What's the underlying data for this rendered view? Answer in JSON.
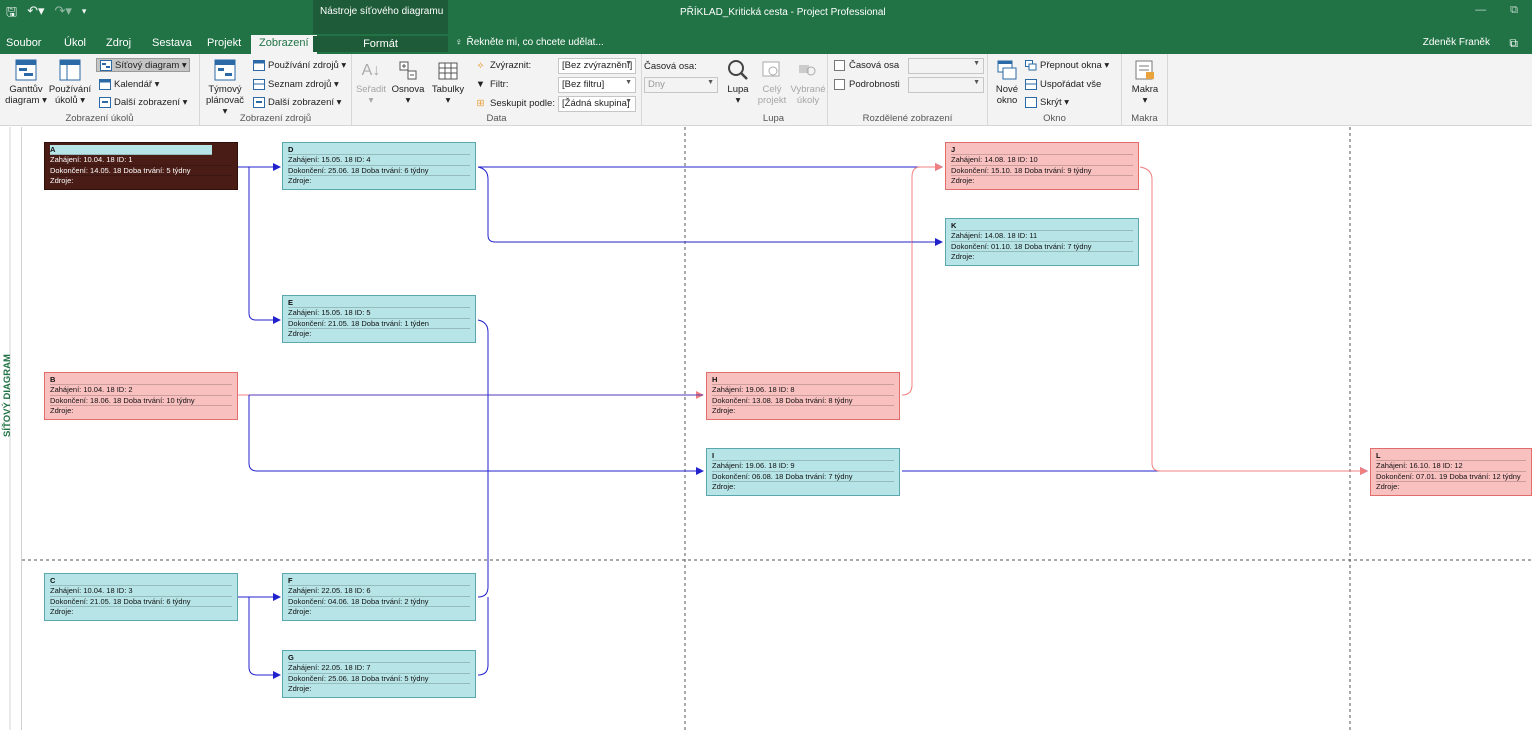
{
  "titlebar": {
    "context_title": "Nástroje síťového diagramu",
    "window_title": "PŘÍKLAD_Kritická cesta - Project Professional",
    "save_icon": "save-icon",
    "undo_icon": "undo-icon",
    "redo_icon": "redo-icon"
  },
  "tabs": {
    "soubor": "Soubor",
    "ukol": "Úkol",
    "zdroj": "Zdroj",
    "sestava": "Sestava",
    "projekt": "Projekt",
    "zobrazeni": "Zobrazení",
    "format": "Formát",
    "tell_me": "Řekněte mi, co chcete udělat...",
    "user": "Zdeněk Franěk"
  },
  "ribbon": {
    "task_views": {
      "gantt_l1": "Ganttův",
      "gantt_l2": "diagram ▾",
      "task_usage_l1": "Používání",
      "task_usage_l2": "úkolů ▾",
      "network": "Síťový diagram ▾",
      "calendar": "Kalendář ▾",
      "other": "Další zobrazení ▾",
      "label": "Zobrazení úkolů"
    },
    "resource_views": {
      "team_l1": "Týmový",
      "team_l2": "plánovač ▾",
      "usage": "Používání zdrojů ▾",
      "sheet": "Seznam zdrojů ▾",
      "other": "Další zobrazení ▾",
      "label": "Zobrazení zdrojů"
    },
    "data": {
      "sort": "Seřadit",
      "outline": "Osnova",
      "tables": "Tabulky",
      "highlight": "Zvýraznit:",
      "highlight_value": "[Bez zvýraznění]",
      "filter": "Filtr:",
      "filter_value": "[Bez filtru]",
      "group": "Seskupit podle:",
      "group_value": "[Žádná skupina]",
      "timescale": "Časová osa:",
      "timescale_value": "Dny",
      "label": "Data"
    },
    "zoom": {
      "zoom": "Lupa",
      "whole_l1": "Celý",
      "whole_l2": "projekt",
      "selected_l1": "Vybrané",
      "selected_l2": "úkoly",
      "label": "Lupa"
    },
    "split": {
      "timeline": "Časová osa",
      "details": "Podrobnosti",
      "label": "Rozdělené zobrazení"
    },
    "window": {
      "new_l1": "Nové",
      "new_l2": "okno",
      "switch": "Přepnout okna ▾",
      "arrange": "Uspořádat vše",
      "hide": "Skrýt ▾",
      "label": "Okno"
    },
    "macros": {
      "macros": "Makra",
      "label": "Makra"
    }
  },
  "view_label": "SÍŤOVÝ DIAGRAM",
  "nodes": {
    "A": {
      "name": "A",
      "start": "Zahájení: 10.04. 18   ID: 1",
      "finish": "Dokončení: 14.05. 18 Doba trvání: 5 týdny",
      "res": "Zdroje:"
    },
    "B": {
      "name": "B",
      "start": "Zahájení: 10.04. 18   ID: 2",
      "finish": "Dokončení: 18.06. 18 Doba trvání: 10 týdny",
      "res": "Zdroje:"
    },
    "C": {
      "name": "C",
      "start": "Zahájení: 10.04. 18   ID: 3",
      "finish": "Dokončení: 21.05. 18 Doba trvání: 6 týdny",
      "res": "Zdroje:"
    },
    "D": {
      "name": "D",
      "start": "Zahájení: 15.05. 18   ID: 4",
      "finish": "Dokončení: 25.06. 18 Doba trvání: 6 týdny",
      "res": "Zdroje:"
    },
    "E": {
      "name": "E",
      "start": "Zahájení: 15.05. 18   ID: 5",
      "finish": "Dokončení: 21.05. 18 Doba trvání: 1 týden",
      "res": "Zdroje:"
    },
    "F": {
      "name": "F",
      "start": "Zahájení: 22.05. 18   ID: 6",
      "finish": "Dokončení: 04.06. 18 Doba trvání: 2 týdny",
      "res": "Zdroje:"
    },
    "G": {
      "name": "G",
      "start": "Zahájení: 22.05. 18   ID: 7",
      "finish": "Dokončení: 25.06. 18 Doba trvání: 5 týdny",
      "res": "Zdroje:"
    },
    "H": {
      "name": "H",
      "start": "Zahájení: 19.06. 18   ID: 8",
      "finish": "Dokončení: 13.08. 18 Doba trvání: 8 týdny",
      "res": "Zdroje:"
    },
    "I": {
      "name": "I",
      "start": "Zahájení: 19.06. 18   ID: 9",
      "finish": "Dokončení: 06.08. 18 Doba trvání: 7 týdny",
      "res": "Zdroje:"
    },
    "J": {
      "name": "J",
      "start": "Zahájení: 14.08. 18   ID: 10",
      "finish": "Dokončení: 15.10. 18 Doba trvání: 9 týdny",
      "res": "Zdroje:"
    },
    "K": {
      "name": "K",
      "start": "Zahájení: 14.08. 18   ID: 11",
      "finish": "Dokončení: 01.10. 18 Doba trvání: 7 týdny",
      "res": "Zdroje:"
    },
    "L": {
      "name": "L",
      "start": "Zahájení: 16.10. 18   ID: 12",
      "finish": "Dokončení: 07.01. 19 Doba trvání: 12 týdny",
      "res": "Zdroje:"
    }
  },
  "colors": {
    "ribbon_green": "#217346",
    "normal_link": "#2222cc",
    "critical_link": "#f08080",
    "normal_node": "#b7e4e7",
    "critical_node": "#f9c0c0",
    "selected_node": "#4a1c16"
  }
}
